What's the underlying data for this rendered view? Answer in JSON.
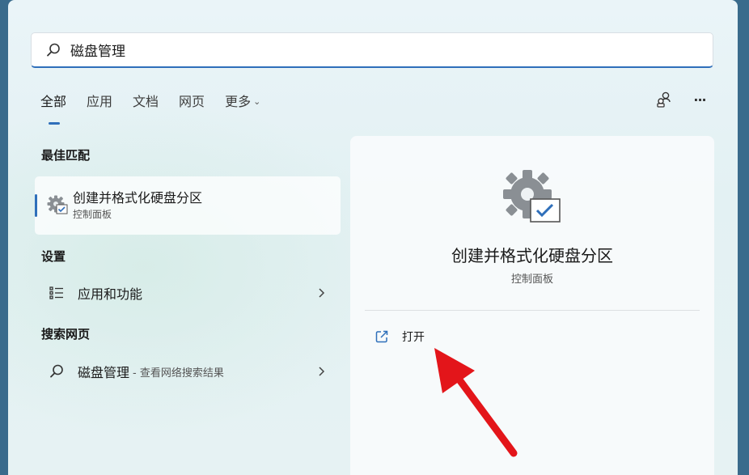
{
  "search": {
    "query": "磁盘管理",
    "icon": "search-icon"
  },
  "tabs": [
    {
      "label": "全部",
      "active": true
    },
    {
      "label": "应用",
      "active": false
    },
    {
      "label": "文档",
      "active": false
    },
    {
      "label": "网页",
      "active": false
    },
    {
      "label": "更多",
      "active": false,
      "chevron": "⌄"
    }
  ],
  "toolbar": {
    "icons": [
      "account-switch-icon",
      "more-options-icon"
    ],
    "more_glyph": "···"
  },
  "sections": {
    "best_match": "最佳匹配",
    "settings": "设置",
    "web_search": "搜索网页"
  },
  "best_match": {
    "title": "创建并格式化硬盘分区",
    "subtitle": "控制面板",
    "icon": "settings-gear-check-icon"
  },
  "settings_items": [
    {
      "label": "应用和功能",
      "icon": "list-icon"
    }
  ],
  "web_items": [
    {
      "label": "磁盘管理",
      "suffix": "- 查看网络搜索结果",
      "icon": "search-icon"
    }
  ],
  "detail": {
    "title": "创建并格式化硬盘分区",
    "subtitle": "控制面板",
    "icon": "settings-gear-check-icon",
    "actions": [
      {
        "label": "打开",
        "icon": "open-external-icon"
      }
    ]
  },
  "colors": {
    "accent": "#2f6fba",
    "annotation_arrow": "#e3151a"
  }
}
